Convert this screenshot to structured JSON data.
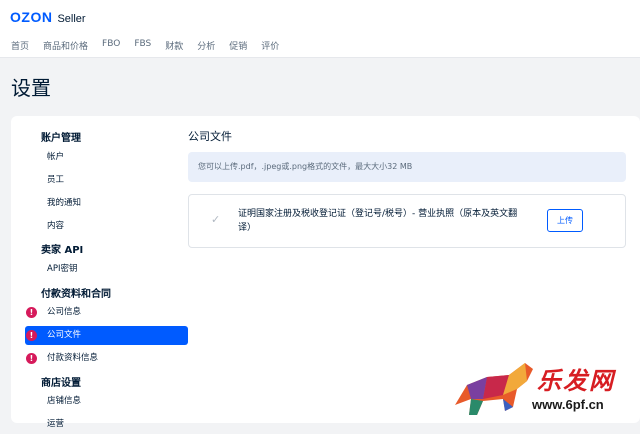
{
  "brand": {
    "name": "OZON",
    "product": "Seller"
  },
  "nav": [
    "首页",
    "商品和价格",
    "FBO",
    "FBS",
    "财款",
    "分析",
    "促销",
    "评价"
  ],
  "page_title": "设置",
  "sidebar": {
    "sections": [
      {
        "title": "账户管理",
        "items": [
          "帐户",
          "员工",
          "我的通知",
          "内容"
        ]
      },
      {
        "title": "卖家 API",
        "items": [
          "API密钥"
        ]
      },
      {
        "title": "付款资料和合同",
        "items": [
          "公司信息",
          "公司文件",
          "付款资料信息"
        ]
      },
      {
        "title": "商店设置",
        "items": [
          "店铺信息",
          "运营"
        ]
      }
    ],
    "active_item": "公司文件",
    "warning_mark": "!"
  },
  "main": {
    "title": "公司文件",
    "info": "您可以上传.pdf，.jpeg或.png格式的文件，最大大小32 MB",
    "document": {
      "check": "✓",
      "label": "证明国家注册及税收登记证（登记号/税号）- 营业执照（原本及英文翻译）",
      "upload_label": "上传"
    }
  },
  "watermark": {
    "text": "乐发网",
    "url": "www.6pf.cn"
  },
  "colors": {
    "accent": "#005bff",
    "warning": "#d61a5b",
    "info_bg": "#e9effa"
  }
}
